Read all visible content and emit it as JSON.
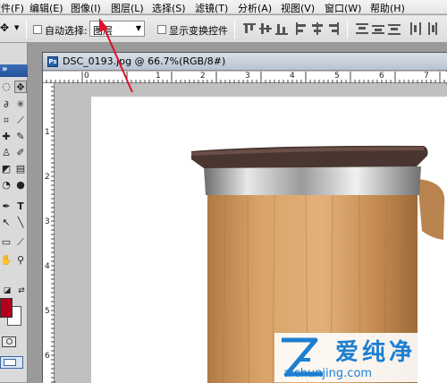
{
  "menubar": {
    "items": [
      {
        "label": "文件(F)"
      },
      {
        "label": "编辑(E)"
      },
      {
        "label": "图像(I)"
      },
      {
        "label": "图层(L)"
      },
      {
        "label": "选择(S)"
      },
      {
        "label": "滤镜(T)"
      },
      {
        "label": "分析(A)"
      },
      {
        "label": "视图(V)"
      },
      {
        "label": "窗口(W)"
      },
      {
        "label": "帮助(H)"
      }
    ]
  },
  "options_bar": {
    "auto_select_label": "自动选择:",
    "auto_select_value": "图层",
    "show_transform_label": "显示变换控件"
  },
  "document": {
    "title": "DSC_0193.jpg @ 66.7%(RGB/8#)",
    "ruler_h": [
      "0",
      "1",
      "2",
      "3",
      "4",
      "5",
      "6",
      "7"
    ],
    "ruler_v": [
      "1",
      "2",
      "3",
      "4",
      "5",
      "6"
    ]
  },
  "colors": {
    "foreground": "#b3001b",
    "background": "#ffffff",
    "arrow": "#e0102a",
    "menubar": "#ececec",
    "title_accent": "#2c5fa8"
  },
  "watermark": {
    "name": "爱纯净",
    "url": "aichunjing.com"
  }
}
